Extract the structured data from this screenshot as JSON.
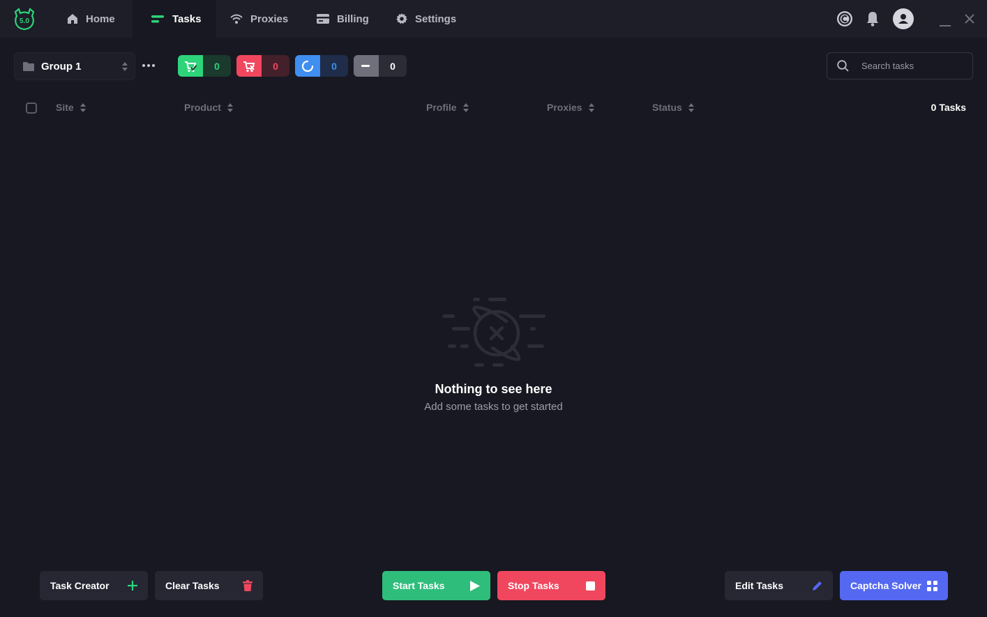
{
  "logo": {
    "badge": "5.0"
  },
  "nav": [
    {
      "label": "Home",
      "icon": "home-icon"
    },
    {
      "label": "Tasks",
      "icon": "tasks-icon",
      "active": true
    },
    {
      "label": "Proxies",
      "icon": "wifi-icon"
    },
    {
      "label": "Billing",
      "icon": "card-icon"
    },
    {
      "label": "Settings",
      "icon": "gear-icon"
    }
  ],
  "group": {
    "label": "Group 1"
  },
  "stats": [
    {
      "name": "success",
      "value": "0",
      "color": "#2ed47a"
    },
    {
      "name": "failed",
      "value": "0",
      "color": "#f0475f"
    },
    {
      "name": "running",
      "value": "0",
      "color": "#3f8ef0"
    },
    {
      "name": "idle",
      "value": "0",
      "color": "#6f707c"
    }
  ],
  "search": {
    "placeholder": "Search tasks"
  },
  "table": {
    "columns": [
      "Site",
      "Product",
      "Profile",
      "Proxies",
      "Status"
    ],
    "count_label": "0 Tasks"
  },
  "empty": {
    "title": "Nothing to see here",
    "subtitle": "Add some tasks to get started"
  },
  "actions": {
    "task_creator": "Task Creator",
    "clear_tasks": "Clear Tasks",
    "start_tasks": "Start Tasks",
    "stop_tasks": "Stop Tasks",
    "edit_tasks": "Edit Tasks",
    "captcha_solver": "Captcha Solver"
  }
}
